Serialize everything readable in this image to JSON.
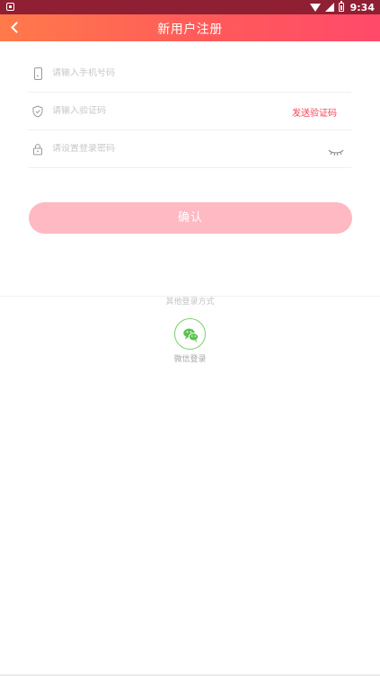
{
  "status_bar": {
    "time": "9:34"
  },
  "header": {
    "title": "新用户注册"
  },
  "form": {
    "phone": {
      "placeholder": "请输入手机号码",
      "value": ""
    },
    "code": {
      "placeholder": "请输入验证码",
      "value": "",
      "send_label": "发送验证码"
    },
    "password": {
      "placeholder": "请设置登录密码",
      "value": ""
    }
  },
  "confirm_label": "确认",
  "other_login": {
    "title": "其他登录方式",
    "wechat_label": "微信登录"
  },
  "colors": {
    "accent": "#f2445a",
    "button_disabled": "#ffb9c3",
    "wechat": "#5bc34e"
  }
}
